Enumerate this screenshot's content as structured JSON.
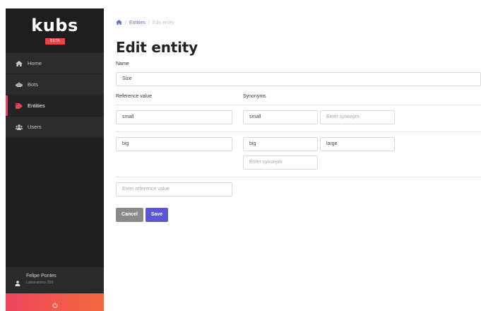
{
  "app": {
    "brand": "kubs",
    "badge": "BETA"
  },
  "sidebar": {
    "items": [
      {
        "label": "Home",
        "icon": "home-icon"
      },
      {
        "label": "Bots",
        "icon": "bot-icon"
      },
      {
        "label": "Entities",
        "icon": "tag-icon",
        "active": true
      },
      {
        "label": "Users",
        "icon": "users-icon"
      }
    ],
    "user": {
      "name": "Felipe Pontes",
      "org": "Laboratório 259"
    },
    "logout_icon": "power-icon"
  },
  "breadcrumb": {
    "home_icon": "home-icon",
    "items": [
      "Entities",
      "Edit entity"
    ]
  },
  "page": {
    "title": "Edit entity",
    "name_label": "Name",
    "name_value": "Size",
    "reference_header": "Reference value",
    "synonyms_header": "Synonyms"
  },
  "entries": [
    {
      "reference": "small",
      "synonyms": [
        "small"
      ],
      "synonym_placeholder": "Enter synonym"
    },
    {
      "reference": "big",
      "synonyms": [
        "big",
        "large"
      ],
      "synonym_placeholder": "Enter synonym"
    }
  ],
  "new_reference_placeholder": "Enter reference value",
  "buttons": {
    "cancel": "Cancel",
    "save": "Save"
  },
  "colors": {
    "accent": "#5a56d6",
    "sidebar_bg": "#232323",
    "beta_badge": "#f0404a",
    "active_marker": "#e8415b",
    "logout_gradient_start": "#f0455e",
    "logout_gradient_end": "#f3683e",
    "cancel_button": "#8a8a8a",
    "link": "#5b6ee1"
  }
}
